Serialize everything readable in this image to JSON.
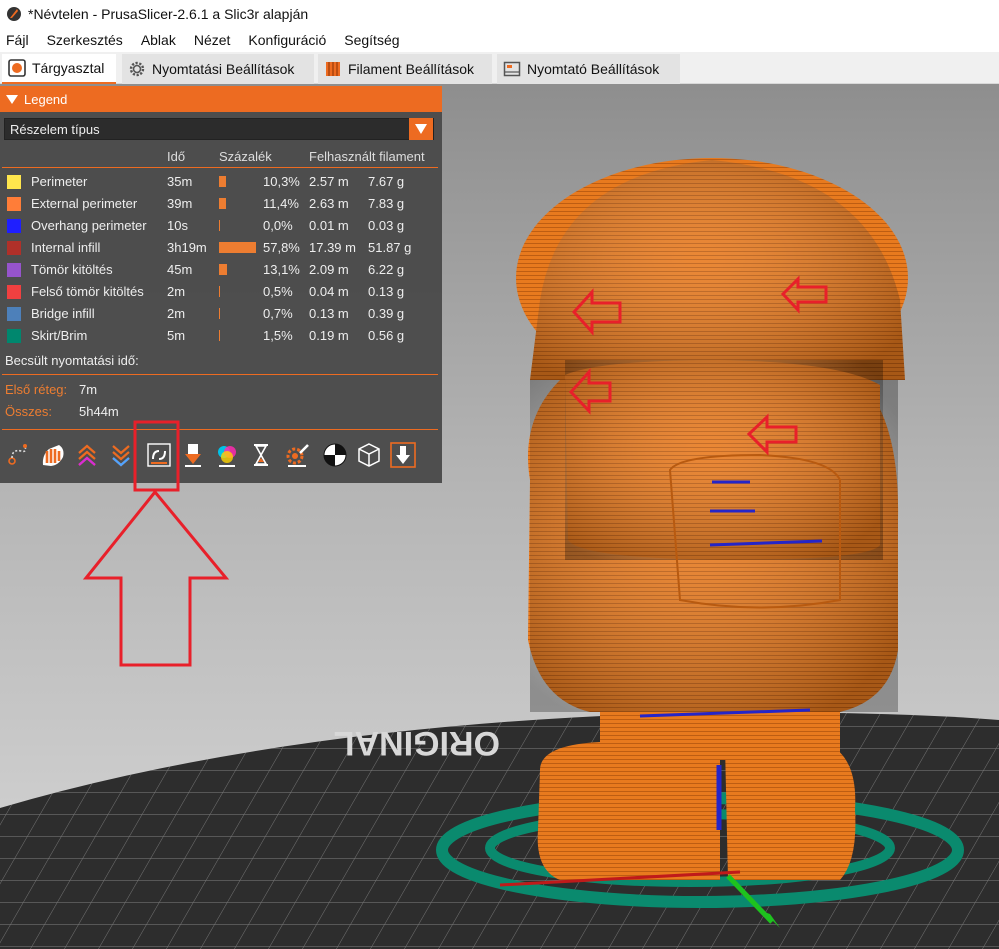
{
  "window": {
    "title": "*Névtelen - PrusaSlicer-2.6.1 a Slic3r alapján"
  },
  "menu": [
    "Fájl",
    "Szerkesztés",
    "Ablak",
    "Nézet",
    "Konfiguráció",
    "Segítség"
  ],
  "tabs": [
    {
      "label": "Tárgyasztal",
      "icon": "plater-icon",
      "active": true
    },
    {
      "label": "Nyomtatási Beállítások",
      "icon": "gear-icon",
      "active": false
    },
    {
      "label": "Filament Beállítások",
      "icon": "filament-spool-icon",
      "active": false
    },
    {
      "label": "Nyomtató Beállítások",
      "icon": "printer-icon",
      "active": false
    }
  ],
  "legend": {
    "title": "Legend",
    "view_type": "Részelem típus",
    "headers": {
      "time": "Idő",
      "percent": "Százalék",
      "filament": "Felhasznált filament"
    },
    "rows": [
      {
        "name": "Perimeter",
        "color": "#ffe64d",
        "time": "35m",
        "percent_value": 10.3,
        "percent": "10,3%",
        "length": "2.57 m",
        "weight": "7.67 g"
      },
      {
        "name": "External perimeter",
        "color": "#ff7d38",
        "time": "39m",
        "percent_value": 11.4,
        "percent": "11,4%",
        "length": "2.63 m",
        "weight": "7.83 g"
      },
      {
        "name": "Overhang perimeter",
        "color": "#1f1fff",
        "time": "10s",
        "percent_value": 0.0,
        "percent": "0,0%",
        "length": "0.01 m",
        "weight": "0.03 g"
      },
      {
        "name": "Internal infill",
        "color": "#b03029",
        "time": "3h19m",
        "percent_value": 57.8,
        "percent": "57,8%",
        "length": "17.39 m",
        "weight": "51.87 g"
      },
      {
        "name": "Tömör kitöltés",
        "color": "#9654cc",
        "time": "45m",
        "percent_value": 13.1,
        "percent": "13,1%",
        "length": "2.09 m",
        "weight": "6.22 g"
      },
      {
        "name": "Felső tömör kitöltés",
        "color": "#f04040",
        "time": "2m",
        "percent_value": 0.5,
        "percent": "0,5%",
        "length": "0.04 m",
        "weight": "0.13 g"
      },
      {
        "name": "Bridge infill",
        "color": "#4d80ba",
        "time": "2m",
        "percent_value": 0.7,
        "percent": "0,7%",
        "length": "0.13 m",
        "weight": "0.39 g"
      },
      {
        "name": "Skirt/Brim",
        "color": "#00876e",
        "time": "5m",
        "percent_value": 1.5,
        "percent": "1,5%",
        "length": "0.19 m",
        "weight": "0.56 g"
      }
    ],
    "estimate_label": "Becsült nyomtatási idő:",
    "first_layer_label": "Első réteg:",
    "first_layer_value": "7m",
    "total_label": "Összes:",
    "total_value": "5h44m"
  },
  "toolbar": [
    "travel-icon",
    "wipe-icon",
    "retractions-icon",
    "deretractions-icon",
    "seams-icon",
    "tool-changes-icon",
    "color-changes-icon",
    "pause-prints-icon",
    "custom-gcodes-icon",
    "center-of-gravity-icon",
    "shells-icon",
    "tool-marker-icon"
  ],
  "bed_text": "ORIGINAL",
  "colors": {
    "accent": "#ed6b21",
    "model": "#e87a1e",
    "annotation": "#e8202a"
  }
}
